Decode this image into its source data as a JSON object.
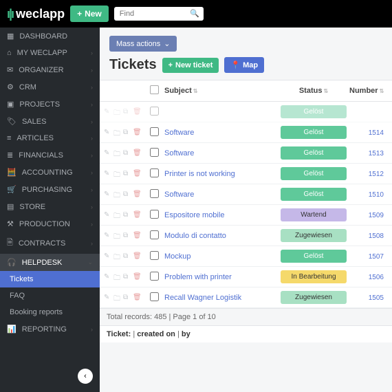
{
  "topbar": {
    "new_label": "New",
    "search_placeholder": "Find"
  },
  "sidebar": {
    "items": [
      {
        "icon": "▦",
        "label": "DASHBOARD",
        "chev": false
      },
      {
        "icon": "⌂",
        "label": "MY WECLAPP",
        "chev": true
      },
      {
        "icon": "✉",
        "label": "ORGANIZER",
        "chev": true
      },
      {
        "icon": "⚙",
        "label": "CRM",
        "chev": true
      },
      {
        "icon": "▣",
        "label": "PROJECTS",
        "chev": true
      },
      {
        "icon": "🏷",
        "label": "SALES",
        "chev": true
      },
      {
        "icon": "≡",
        "label": "ARTICLES",
        "chev": true
      },
      {
        "icon": "≣",
        "label": "FINANCIALS",
        "chev": true
      },
      {
        "icon": "🧮",
        "label": "ACCOUNTING",
        "chev": true
      },
      {
        "icon": "🛒",
        "label": "PURCHASING",
        "chev": true
      },
      {
        "icon": "▤",
        "label": "STORE",
        "chev": true
      },
      {
        "icon": "⚒",
        "label": "PRODUCTION",
        "chev": true
      },
      {
        "icon": "🗎",
        "label": "CONTRACTS",
        "chev": true
      },
      {
        "icon": "🎧",
        "label": "HELPDESK",
        "chev": true,
        "active": true
      },
      {
        "icon": "📊",
        "label": "REPORTING",
        "chev": true
      }
    ],
    "sub_items": [
      {
        "label": "Tickets",
        "sel": true
      },
      {
        "label": "FAQ",
        "sel": false
      },
      {
        "label": "Booking reports",
        "sel": false
      }
    ]
  },
  "mass_actions_label": "Mass actions",
  "page_title": "Tickets",
  "new_ticket_label": "New ticket",
  "map_label": "Map",
  "columns": {
    "subject": "Subject",
    "status": "Status",
    "number": "Number"
  },
  "rows": [
    {
      "subject": "",
      "status": "Gelöst",
      "status_class": "st-geloest",
      "number": "",
      "partial": true
    },
    {
      "subject": "Software",
      "status": "Gelöst",
      "status_class": "st-geloest",
      "number": "1514"
    },
    {
      "subject": "Software",
      "status": "Gelöst",
      "status_class": "st-geloest",
      "number": "1513"
    },
    {
      "subject": "Printer is not working",
      "status": "Gelöst",
      "status_class": "st-geloest",
      "number": "1512"
    },
    {
      "subject": "Software",
      "status": "Gelöst",
      "status_class": "st-geloest",
      "number": "1510"
    },
    {
      "subject": "Espositore mobile",
      "status": "Wartend",
      "status_class": "st-wartend",
      "number": "1509"
    },
    {
      "subject": "Modulo di contatto",
      "status": "Zugewiesen",
      "status_class": "st-zugewiesen",
      "number": "1508"
    },
    {
      "subject": "Mockup",
      "status": "Gelöst",
      "status_class": "st-geloest",
      "number": "1507"
    },
    {
      "subject": "Problem with printer",
      "status": "In Bearbeitung",
      "status_class": "st-inbearbeitung",
      "number": "1506"
    },
    {
      "subject": "Recall Wagner Logistik",
      "status": "Zugewiesen",
      "status_class": "st-zugewiesen",
      "number": "1505"
    }
  ],
  "footer_records": "Total records: 485 | Page 1 of 10",
  "footer_info": {
    "label": "Ticket:",
    "created": "created on",
    "by": "by"
  }
}
